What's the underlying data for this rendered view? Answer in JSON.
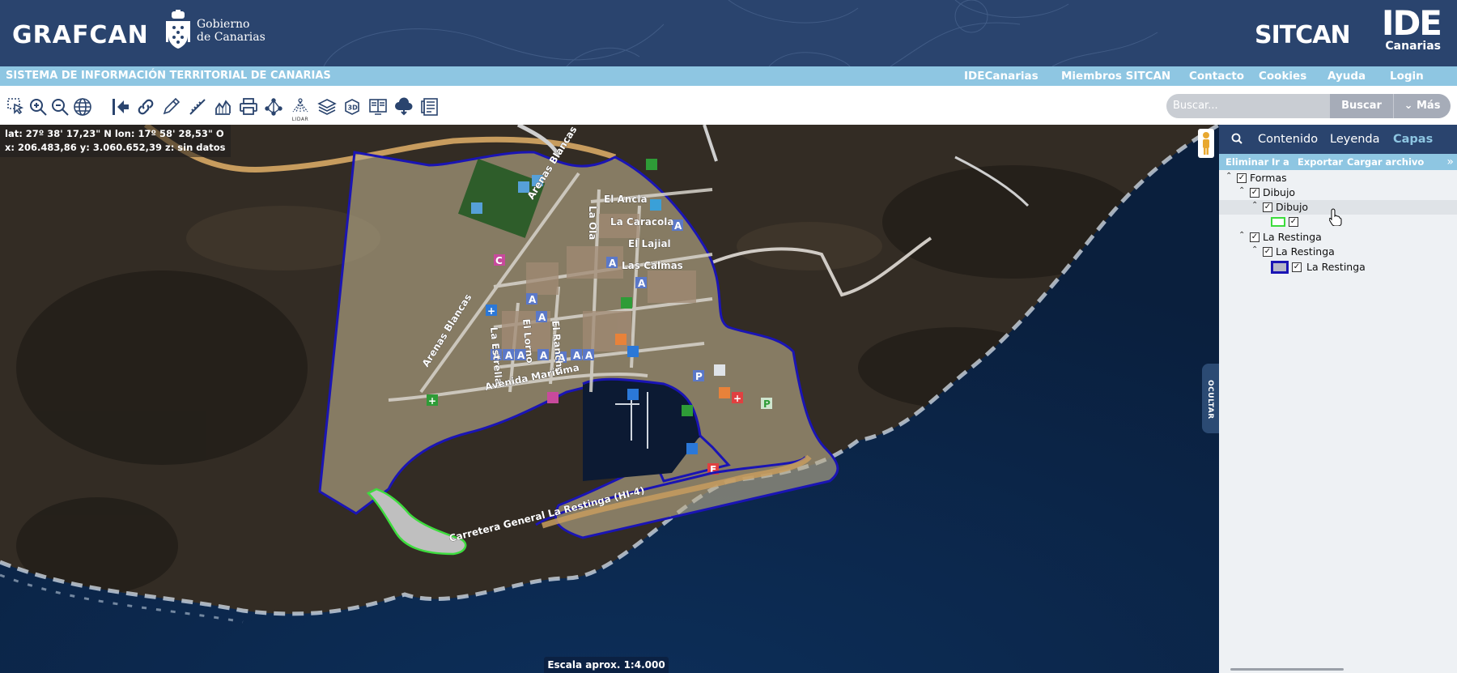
{
  "header": {
    "brand_left": "GRAFCAN",
    "gob_line1": "Gobierno",
    "gob_line2": "de Canarias",
    "brand_sitcan": "SITCAN",
    "brand_ide": "IDE",
    "brand_ide_sub": "Canarias",
    "bg_color": "#2a446e"
  },
  "navbar": {
    "title": "SISTEMA DE INFORMACIÓN TERRITORIAL DE CANARIAS",
    "links": [
      "IDECanarias",
      "Miembros SITCAN",
      "Contacto",
      "Cookies",
      "Ayuda",
      "Login"
    ],
    "bg_color": "#8ec6e2"
  },
  "toolbar": {
    "tools": [
      "select-icon",
      "zoom-in-icon",
      "zoom-out-icon",
      "globe-icon",
      "full-extent-icon",
      "link-icon",
      "pencil-icon",
      "ruler-icon",
      "profile-chart-icon",
      "print-icon",
      "network-icon",
      "lidar-icon",
      "layers-icon",
      "3d-icon",
      "compare-views-icon",
      "cloud-download-icon",
      "report-icon"
    ],
    "lidar_label": "LIDAR",
    "search_placeholder": "Buscar...",
    "search_button": "Buscar",
    "more_button": "Más"
  },
  "map": {
    "coords_line1": "lat: 27º 38' 17,23\" N  lon: 17º 58' 28,53\" O",
    "coords_line2": "x: 206.483,86  y: 3.060.652,39  z: sin datos",
    "scale": "Escala aprox. 1:4.000",
    "hide_tab": "OCULTAR",
    "street_labels": [
      "El Ancla",
      "La Caracola",
      "El Lajial",
      "Las Calmas",
      "La Ola",
      "Arenas Blancas",
      "Arenas Blancas",
      "La Estrella",
      "El Lorno",
      "El Rancho",
      "Avenida Marítima",
      "Carretera General La Restinga (HI-4)"
    ],
    "polygon_color": "#1a14b4",
    "drawing_color": "#3ddc3d"
  },
  "panel": {
    "tabs": [
      "Contenido",
      "Leyenda",
      "Capas"
    ],
    "active_tab": "Capas",
    "actions": [
      "Eliminar",
      "Ir a",
      "Exportar",
      "Cargar archivo"
    ],
    "layers": {
      "formas": "Formas",
      "dibujo_group": "Dibujo",
      "dibujo_layer": "Dibujo",
      "restinga_group": "La Restinga",
      "restinga_layer": "La Restinga",
      "restinga_item": "La Restinga"
    }
  }
}
